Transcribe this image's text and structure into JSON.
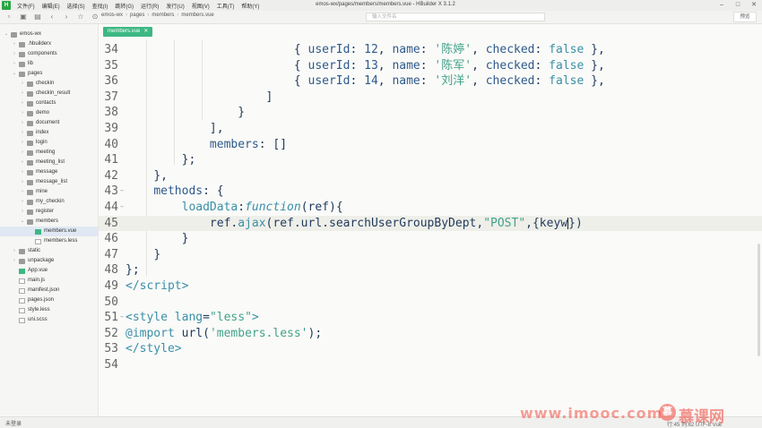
{
  "window": {
    "title": "emos-wx/pages/members/members.vue - HBuilder X 3.1.2",
    "logo": "H",
    "menu": [
      "文件(F)",
      "编辑(E)",
      "选择(S)",
      "查找(I)",
      "跳转(G)",
      "运行(R)",
      "发行(U)",
      "视图(V)",
      "工具(T)",
      "帮助(Y)"
    ]
  },
  "toolbar": {
    "breadcrumb": [
      "emos-wx",
      "pages",
      "members",
      "members.vue"
    ],
    "search_placeholder": "输入文件名",
    "preview_label": "预览"
  },
  "sidebar": {
    "items": [
      {
        "label": "emos-wx",
        "depth": 0,
        "kind": "folder",
        "open": true
      },
      {
        "label": ".hbuilderx",
        "depth": 1,
        "kind": "folder",
        "open": false
      },
      {
        "label": "components",
        "depth": 1,
        "kind": "folder",
        "open": false
      },
      {
        "label": "lib",
        "depth": 1,
        "kind": "folder",
        "open": false
      },
      {
        "label": "pages",
        "depth": 1,
        "kind": "folder",
        "open": true
      },
      {
        "label": "checkin",
        "depth": 2,
        "kind": "folder",
        "open": false
      },
      {
        "label": "checkin_result",
        "depth": 2,
        "kind": "folder",
        "open": false
      },
      {
        "label": "contacts",
        "depth": 2,
        "kind": "folder",
        "open": false
      },
      {
        "label": "demo",
        "depth": 2,
        "kind": "folder",
        "open": false
      },
      {
        "label": "document",
        "depth": 2,
        "kind": "folder",
        "open": false
      },
      {
        "label": "index",
        "depth": 2,
        "kind": "folder",
        "open": false
      },
      {
        "label": "login",
        "depth": 2,
        "kind": "folder",
        "open": false
      },
      {
        "label": "meeting",
        "depth": 2,
        "kind": "folder",
        "open": false
      },
      {
        "label": "meeting_list",
        "depth": 2,
        "kind": "folder",
        "open": false
      },
      {
        "label": "message",
        "depth": 2,
        "kind": "folder",
        "open": false
      },
      {
        "label": "message_list",
        "depth": 2,
        "kind": "folder",
        "open": false
      },
      {
        "label": "mine",
        "depth": 2,
        "kind": "folder",
        "open": false
      },
      {
        "label": "my_checkin",
        "depth": 2,
        "kind": "folder",
        "open": false
      },
      {
        "label": "register",
        "depth": 2,
        "kind": "folder",
        "open": false
      },
      {
        "label": "members",
        "depth": 2,
        "kind": "folder",
        "open": true
      },
      {
        "label": "members.vue",
        "depth": 3,
        "kind": "vue",
        "selected": true
      },
      {
        "label": "members.less",
        "depth": 3,
        "kind": "file"
      },
      {
        "label": "static",
        "depth": 1,
        "kind": "folder",
        "open": false
      },
      {
        "label": "unpackage",
        "depth": 1,
        "kind": "folder",
        "open": false
      },
      {
        "label": "App.vue",
        "depth": 1,
        "kind": "vue"
      },
      {
        "label": "main.js",
        "depth": 1,
        "kind": "file"
      },
      {
        "label": "manifest.json",
        "depth": 1,
        "kind": "file"
      },
      {
        "label": "pages.json",
        "depth": 1,
        "kind": "file"
      },
      {
        "label": "style.less",
        "depth": 1,
        "kind": "file"
      },
      {
        "label": "uni.scss",
        "depth": 1,
        "kind": "file"
      }
    ]
  },
  "editor": {
    "tab_label": "members.vue",
    "current_line": 45,
    "lines": [
      {
        "n": "34",
        "fold": "",
        "html": "                        <span class='p'>{ </span><span class='n'>userId</span><span class='p'>: </span><span class='n'>12</span><span class='p'>, </span><span class='n'>name</span><span class='p'>: </span><span class='s'>'陈婷'</span><span class='p'>, </span><span class='n'>checked</span><span class='p'>: </span><span class='k'>false</span><span class='p'> },</span>"
      },
      {
        "n": "35",
        "fold": "",
        "html": "                        <span class='p'>{ </span><span class='n'>userId</span><span class='p'>: </span><span class='n'>13</span><span class='p'>, </span><span class='n'>name</span><span class='p'>: </span><span class='s'>'陈军'</span><span class='p'>, </span><span class='n'>checked</span><span class='p'>: </span><span class='k'>false</span><span class='p'> },</span>"
      },
      {
        "n": "36",
        "fold": "",
        "html": "                        <span class='p'>{ </span><span class='n'>userId</span><span class='p'>: </span><span class='n'>14</span><span class='p'>, </span><span class='n'>name</span><span class='p'>: </span><span class='s'>'刘洋'</span><span class='p'>, </span><span class='n'>checked</span><span class='p'>: </span><span class='k'>false</span><span class='p'> },</span>"
      },
      {
        "n": "37",
        "fold": "",
        "html": "                    <span class='p'>]</span>"
      },
      {
        "n": "38",
        "fold": "",
        "html": "                <span class='p'>}</span>"
      },
      {
        "n": "39",
        "fold": "",
        "html": "            <span class='p'>],</span>"
      },
      {
        "n": "40",
        "fold": "",
        "html": "            <span class='n'>members</span><span class='p'>: []</span>"
      },
      {
        "n": "41",
        "fold": "",
        "html": "        <span class='p'>};</span>"
      },
      {
        "n": "42",
        "fold": "",
        "html": "    <span class='p'>},</span>"
      },
      {
        "n": "43",
        "fold": "−",
        "html": "    <span class='n'>methods</span><span class='p'>: {</span>"
      },
      {
        "n": "44",
        "fold": "−",
        "html": "        <span class='k'>loadData</span><span class='p'>:</span><span class='fn'>function</span><span class='p'>(ref){</span>"
      },
      {
        "n": "45",
        "fold": "",
        "html": "            <span class='p'>ref.</span><span class='k'>ajax</span><span class='p'>(ref.url.searchUserGroupByDept,</span><span class='s'>\"POST\"</span><span class='p'>,{keyw</span><span class='caret'></span><span class='p'>})</span>"
      },
      {
        "n": "46",
        "fold": "",
        "html": "        <span class='p'>}</span>"
      },
      {
        "n": "47",
        "fold": "",
        "html": "    <span class='p'>}</span>"
      },
      {
        "n": "48",
        "fold": "",
        "html": "<span class='p'>};</span>"
      },
      {
        "n": "49",
        "fold": "",
        "html": "<span class='tag'>&lt;/script&gt;</span>"
      },
      {
        "n": "50",
        "fold": "",
        "html": ""
      },
      {
        "n": "51",
        "fold": "−",
        "html": "<span class='tag'>&lt;style </span><span class='k'>lang</span><span class='p'>=</span><span class='s'>\"less\"</span><span class='tag'>&gt;</span>"
      },
      {
        "n": "52",
        "fold": "",
        "html": "<span class='k'>@import</span><span class='p'> url(</span><span class='s'>'members.less'</span><span class='p'>);</span>"
      },
      {
        "n": "53",
        "fold": "",
        "html": "<span class='tag'>&lt;/style&gt;</span>"
      },
      {
        "n": "54",
        "fold": "",
        "html": ""
      }
    ]
  },
  "status": {
    "login": "未登录",
    "cursor": "行:45  列:62  UTF-8  Vue"
  },
  "watermark": {
    "url": "www.imooc.com",
    "logo": "慕",
    "cn": "慕课网"
  }
}
